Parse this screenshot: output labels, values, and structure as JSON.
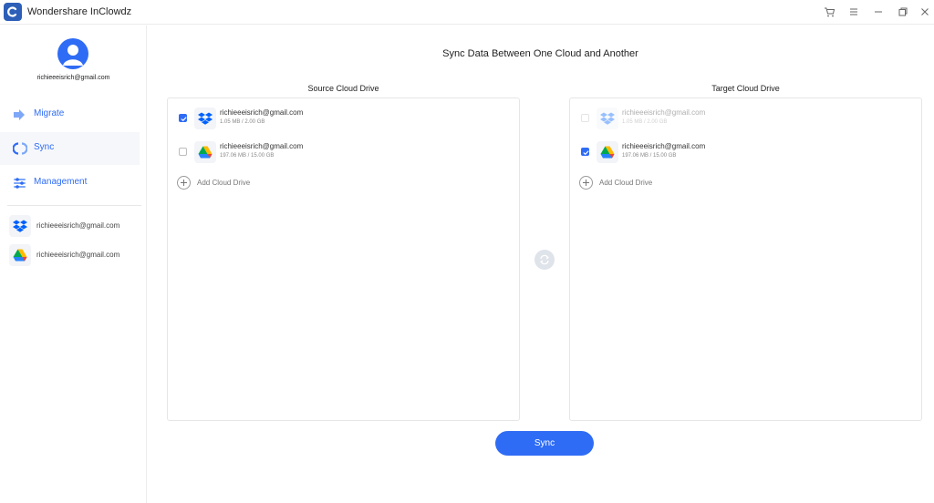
{
  "app": {
    "title": "Wondershare InClowdz"
  },
  "window_controls": [
    "cart-icon",
    "menu-icon",
    "minimize-icon",
    "restore-icon",
    "close-icon"
  ],
  "user": {
    "email": "richieeeisrich@gmail.com"
  },
  "nav": {
    "items": [
      {
        "label": "Migrate",
        "icon": "migrate-arrow-icon",
        "active": false
      },
      {
        "label": "Sync",
        "icon": "sync-icon",
        "active": true
      },
      {
        "label": "Management",
        "icon": "management-sliders-icon",
        "active": false
      }
    ]
  },
  "sidebar_accounts": [
    {
      "service": "Dropbox",
      "email": "richieeeisrich@gmail.com"
    },
    {
      "service": "Google Drive",
      "email": "richieeeisrich@gmail.com"
    }
  ],
  "main": {
    "title": "Sync Data Between One Cloud and Another",
    "sync_button": "Sync"
  },
  "source": {
    "title": "Source Cloud Drive",
    "accounts": [
      {
        "service": "Dropbox",
        "email": "richieeeisrich@gmail.com",
        "size": "1.05 MB / 2.00 GB",
        "checked": true,
        "disabled": false
      },
      {
        "service": "Google Drive",
        "email": "richieeeisrich@gmail.com",
        "size": "197.06 MB / 15.00 GB",
        "checked": false,
        "disabled": false
      }
    ],
    "add_label": "Add Cloud Drive"
  },
  "target": {
    "title": "Target Cloud Drive",
    "accounts": [
      {
        "service": "Dropbox",
        "email": "richieeeisrich@gmail.com",
        "size": "1.05 MB / 2.00 GB",
        "checked": false,
        "disabled": true
      },
      {
        "service": "Google Drive",
        "email": "richieeeisrich@gmail.com",
        "size": "197.06 MB / 15.00 GB",
        "checked": true,
        "disabled": false
      }
    ],
    "add_label": "Add Cloud Drive"
  },
  "colors": {
    "accent": "#2f6cf5",
    "dropbox": "#0061fe",
    "swap_bg": "#dfe3ea"
  }
}
